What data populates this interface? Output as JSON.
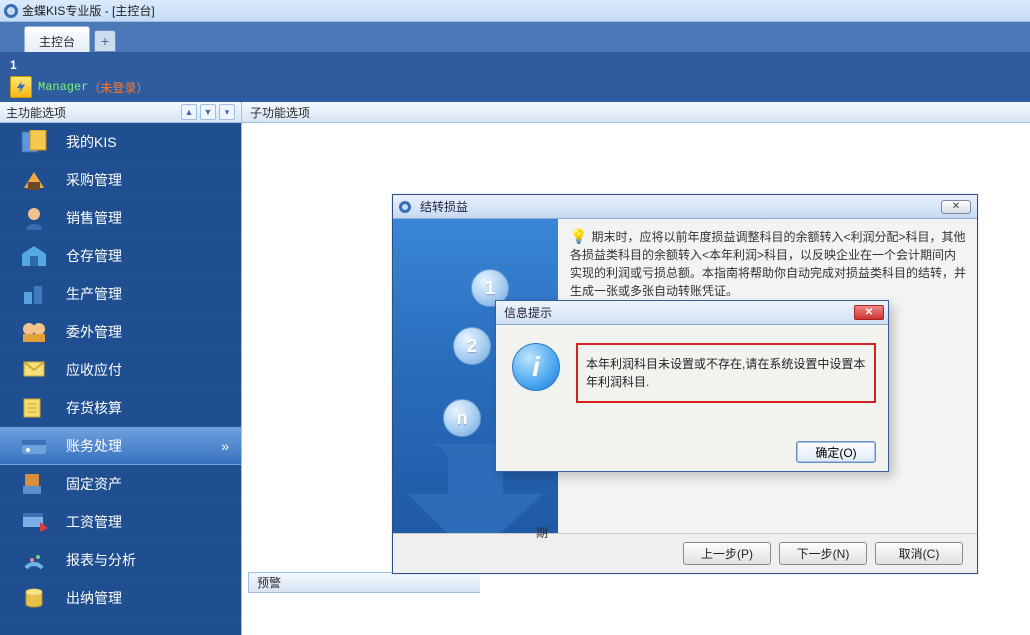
{
  "window": {
    "title": "金蝶KIS专业版 - [主控台]"
  },
  "tabs": {
    "main": "主控台"
  },
  "user": {
    "index": "1",
    "name": "Manager",
    "status": "（未登录）"
  },
  "sidepanel": {
    "header": "主功能选项",
    "items": [
      {
        "label": "我的KIS"
      },
      {
        "label": "采购管理"
      },
      {
        "label": "销售管理"
      },
      {
        "label": "仓存管理"
      },
      {
        "label": "生产管理"
      },
      {
        "label": "委外管理"
      },
      {
        "label": "应收应付"
      },
      {
        "label": "存货核算"
      },
      {
        "label": "账务处理"
      },
      {
        "label": "固定资产"
      },
      {
        "label": "工资管理"
      },
      {
        "label": "报表与分析"
      },
      {
        "label": "出纳管理"
      }
    ],
    "active_index": 8
  },
  "subpanel": {
    "header": "子功能选项"
  },
  "warnpanel": {
    "header": "预警"
  },
  "wizard": {
    "title": "结转损益",
    "steps": [
      "1",
      "2",
      "n"
    ],
    "hint": "期末时，应将以前年度损益调整科目的余额转入<利润分配>科目，其他各损益类科目的余额转入<本年利润>科目，以反映企业在一个会计期间内实现的利润或亏损总额。本指南将帮助你自动完成对损益类科目的结转，并生成一张或多张自动转账凭证。",
    "period_label": "期",
    "buttons": {
      "prev": "上一步(P)",
      "next": "下一步(N)",
      "cancel": "取消(C)"
    }
  },
  "msgbox": {
    "title": "信息提示",
    "text": "本年利润科目未设置或不存在,请在系统设置中设置本年利润科目.",
    "ok": "确定(O)"
  }
}
